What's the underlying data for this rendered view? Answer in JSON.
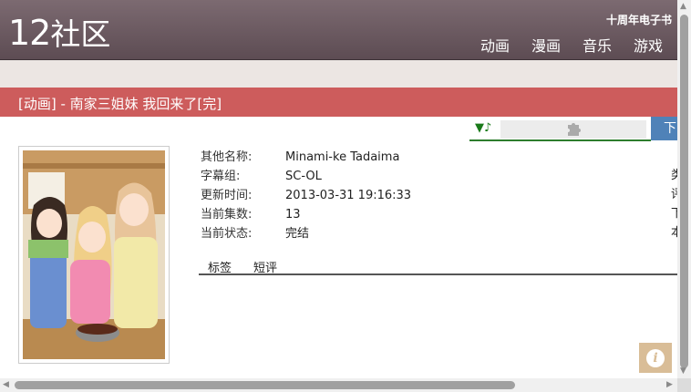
{
  "header": {
    "logo_num": "12",
    "logo_text": "社区",
    "anniversary": "十周年电子书",
    "nav": [
      "动画",
      "漫画",
      "音乐",
      "游戏"
    ]
  },
  "page_title": "[动画] - 南家三姐妹 我回来了[完]",
  "player": {
    "music_icon": "▼♪",
    "plugin_icon": "puzzle-icon"
  },
  "download_label": "下载",
  "info": [
    {
      "label": "其他名称:",
      "value": "Minami-ke Tadaima"
    },
    {
      "label": "字幕组:",
      "value": "SC-OL"
    },
    {
      "label": "更新时间:",
      "value": "2013-03-31 19:16:33"
    },
    {
      "label": "当前集数:",
      "value": "13"
    },
    {
      "label": "当前状态:",
      "value": "完结"
    }
  ],
  "right_col": [
    "类",
    "评",
    "下",
    "本"
  ],
  "tabs": [
    "标签",
    "短评"
  ],
  "colors": {
    "header": "#6b5a61",
    "title_bar": "#cd5c5c",
    "download": "#4f82b8",
    "player_line": "#2d7d2d"
  }
}
